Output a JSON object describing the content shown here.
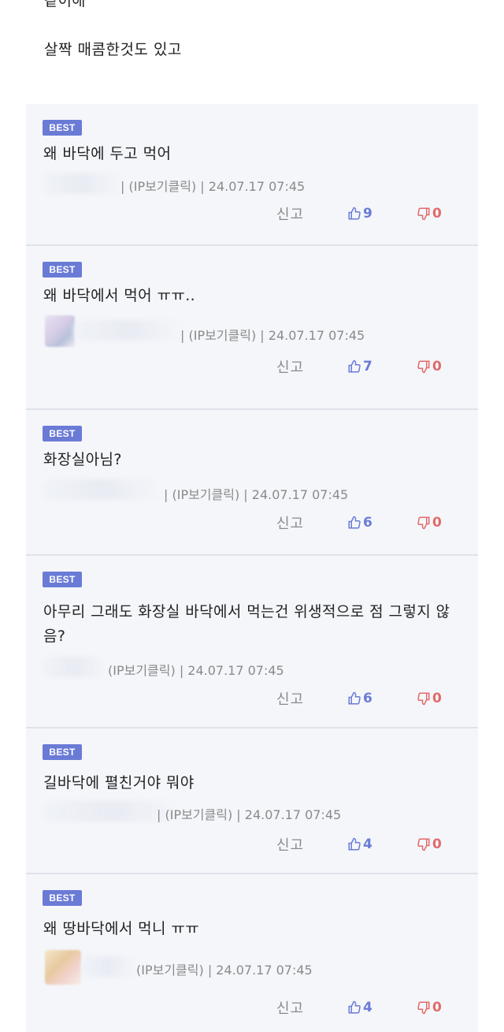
{
  "post": {
    "top_cut_text": "같이해",
    "intro_text": "살짝 매콤한것도 있고"
  },
  "comments": [
    {
      "badge": "BEST",
      "text": "왜 바닥에 두고 먹어",
      "meta": "| (IP보기클릭) | 24.07.17 07:45",
      "report": "신고",
      "up": "9",
      "down": "0"
    },
    {
      "badge": "BEST",
      "text": "왜 바닥에서 먹어 ㅠㅠ..",
      "meta": "| (IP보기클릭) | 24.07.17 07:45",
      "report": "신고",
      "up": "7",
      "down": "0"
    },
    {
      "badge": "BEST",
      "text": "화장실아님?",
      "meta": "| (IP보기클릭) | 24.07.17 07:45",
      "report": "신고",
      "up": "6",
      "down": "0"
    },
    {
      "badge": "BEST",
      "text": "아무리 그래도 화장실 바닥에서 먹는건 위생적으로 점 그렇지 않음?",
      "meta": "(IP보기클릭) | 24.07.17 07:45",
      "report": "신고",
      "up": "6",
      "down": "0"
    },
    {
      "badge": "BEST",
      "text": "길바닥에 펼친거야 뭐야",
      "meta": "| (IP보기클릭) | 24.07.17 07:45",
      "report": "신고",
      "up": "4",
      "down": "0"
    },
    {
      "badge": "BEST",
      "text": "왜 땅바닥에서 먹니 ㅠㅠ",
      "meta": "(IP보기클릭) | 24.07.17 07:45",
      "report": "신고",
      "up": "4",
      "down": "0"
    }
  ],
  "icons": {
    "thumbs_up": "thumbs-up-icon",
    "thumbs_down": "thumbs-down-icon"
  },
  "colors": {
    "badge": "#6a7bd6",
    "up_count": "#6a7bd6",
    "down_count": "#e26a6a",
    "card_bg": "#f4f6fa"
  }
}
